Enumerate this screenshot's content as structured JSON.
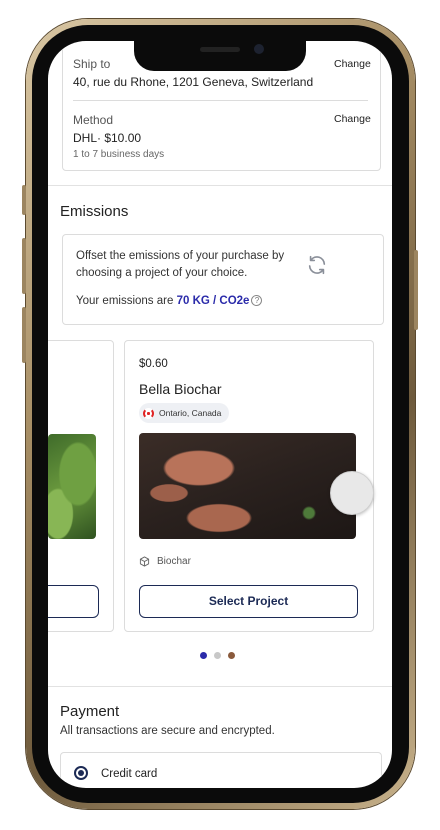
{
  "shipping": {
    "ship_to_label": "Ship to",
    "ship_to_value": "40, rue du Rhone, 1201 Geneva, Switzerland",
    "ship_change": "Change",
    "method_label": "Method",
    "method_value": "DHL· $10.00",
    "method_note": "1 to 7 business days",
    "method_change": "Change"
  },
  "emissions": {
    "heading": "Emissions",
    "offset_text": "Offset the emissions of your purchase by choosing a project of your choice.",
    "emissions_prefix": "Your emissions are",
    "emissions_value": "70 KG / CO2e",
    "info_glyph": "?"
  },
  "projects": [
    {
      "price": "",
      "title": "",
      "location": "",
      "category": "",
      "button": ""
    },
    {
      "price": "$0.60",
      "title": "Bella Biochar",
      "location": "Ontario, Canada",
      "category": "Biochar",
      "button": "Select Project"
    }
  ],
  "carousel": {
    "dot_count": 3,
    "active_index": 0,
    "dot_colors": [
      "#2b2baa",
      "#c8c8c8",
      "#8a5a3c"
    ]
  },
  "payment": {
    "heading": "Payment",
    "subtitle": "All transactions are secure and encrypted.",
    "option_label": "Credit card"
  },
  "colors": {
    "accent": "#2b2baa",
    "navy": "#1c2a55",
    "frame_gold": "#a88f66"
  }
}
